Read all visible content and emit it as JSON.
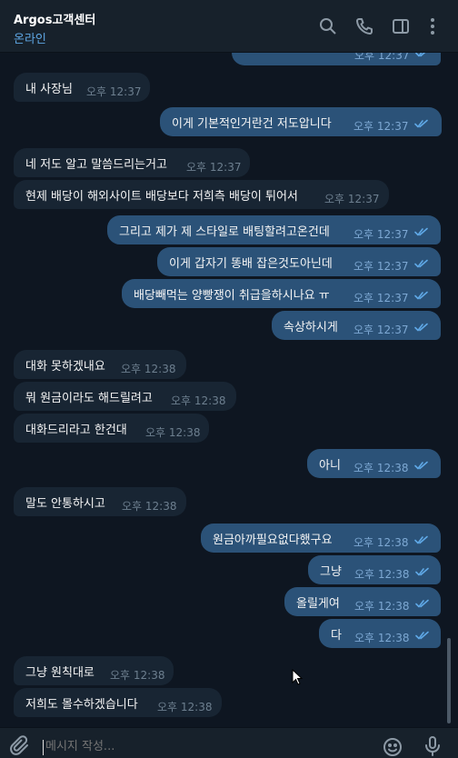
{
  "header": {
    "title": "Argos고객센터",
    "status": "온라인",
    "icons": [
      "search-icon",
      "phone-icon",
      "sidebar-toggle-icon",
      "more-vertical-icon"
    ]
  },
  "colors": {
    "background": "#0e1621",
    "header": "#17212b",
    "incoming_bubble": "#182533",
    "outgoing_bubble": "#2b5278",
    "accent": "#5fa8e6",
    "read_check": "#5fa8e6"
  },
  "messages": [
    {
      "dir": "out",
      "text": "",
      "time": "오후 12:37",
      "read": true
    },
    {
      "dir": "in",
      "text": "내 사장님",
      "time": "오후 12:37"
    },
    {
      "dir": "out",
      "text": "이게 기본적인거란건 저도압니다",
      "time": "오후 12:37",
      "read": true
    },
    {
      "dir": "in",
      "text": "네 저도 알고 말씀드리는거고",
      "time": "오후 12:37"
    },
    {
      "dir": "in",
      "text": "현제 배당이 해외사이트 배당보다 저희측 배당이 튀어서",
      "time": "오후 12:37"
    },
    {
      "dir": "out",
      "text": "그리고 제가 제 스타일로 배팅할려고온건데",
      "time": "오후 12:37",
      "read": true
    },
    {
      "dir": "out",
      "text": "이게 갑자기 똥배 잡은것도아닌데",
      "time": "오후 12:37",
      "read": true
    },
    {
      "dir": "out",
      "text": "배당빼먹는 양빵쟁이 취급을하시나요 ㅠ",
      "time": "오후 12:37",
      "read": true
    },
    {
      "dir": "out",
      "text": "속상하시게",
      "time": "오후 12:37",
      "read": true
    },
    {
      "dir": "in",
      "text": "대화 못하겠내요",
      "time": "오후 12:38"
    },
    {
      "dir": "in",
      "text": "뭐 원금이라도 해드릴려고",
      "time": "오후 12:38"
    },
    {
      "dir": "in",
      "text": "대화드리라고 한건대",
      "time": "오후 12:38"
    },
    {
      "dir": "out",
      "text": "아니",
      "time": "오후 12:38",
      "read": true
    },
    {
      "dir": "in",
      "text": "말도 안통하시고",
      "time": "오후 12:38"
    },
    {
      "dir": "out",
      "text": "원금아까필요없다했구요",
      "time": "오후 12:38",
      "read": true
    },
    {
      "dir": "out",
      "text": "그냥",
      "time": "오후 12:38",
      "read": true
    },
    {
      "dir": "out",
      "text": "올릴게여",
      "time": "오후 12:38",
      "read": true
    },
    {
      "dir": "out",
      "text": "다",
      "time": "오후 12:38",
      "read": true
    },
    {
      "dir": "in",
      "text": "그냥 원칙대로",
      "time": "오후 12:38"
    },
    {
      "dir": "in",
      "text": "저희도 몰수하겠습니다",
      "time": "오후 12:38"
    }
  ],
  "composer": {
    "placeholder": "메시지 작성...",
    "icons": [
      "attach-icon",
      "emoji-icon",
      "microphone-icon"
    ]
  }
}
